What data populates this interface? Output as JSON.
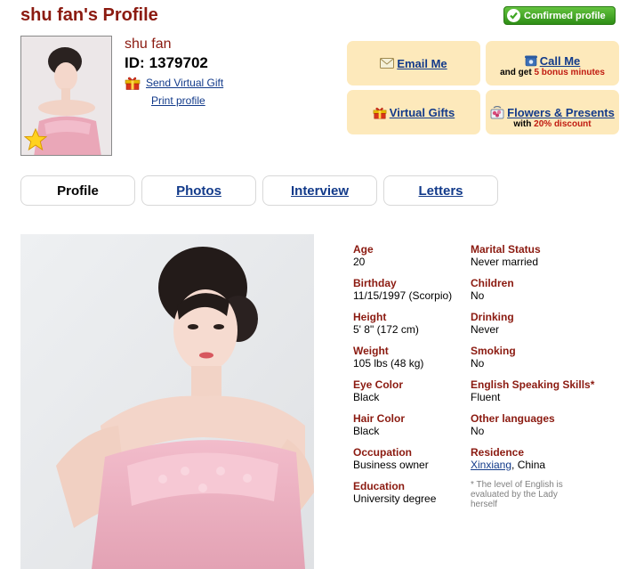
{
  "header": {
    "title": "shu fan's Profile",
    "confirmed_badge": "Confirmed profile"
  },
  "profile": {
    "name": "shu fan",
    "id_label": "ID:",
    "id_value": "1379702",
    "send_gift": "Send Virtual Gift",
    "print_profile": "Print profile"
  },
  "actions": {
    "email": "Email Me",
    "call": "Call Me",
    "call_sub_prefix": "and get",
    "call_sub_highlight": "5 bonus minutes",
    "virtual_gifts": "Virtual Gifts",
    "flowers": "Flowers & Presents",
    "flowers_sub_prefix": "with",
    "flowers_sub_highlight": "20% discount"
  },
  "tabs": [
    {
      "label": "Profile",
      "active": true
    },
    {
      "label": "Photos",
      "active": false
    },
    {
      "label": "Interview",
      "active": false
    },
    {
      "label": "Letters",
      "active": false
    }
  ],
  "details_left": [
    {
      "label": "Age",
      "value": "20"
    },
    {
      "label": "Birthday",
      "value": "11/15/1997 (Scorpio)"
    },
    {
      "label": "Height",
      "value": "5' 8\" (172 cm)"
    },
    {
      "label": "Weight",
      "value": "105 lbs (48 kg)"
    },
    {
      "label": "Eye Color",
      "value": "Black"
    },
    {
      "label": "Hair Color",
      "value": "Black"
    },
    {
      "label": "Occupation",
      "value": "Business owner"
    },
    {
      "label": "Education",
      "value": "University degree"
    }
  ],
  "details_right": [
    {
      "label": "Marital Status",
      "value": "Never married"
    },
    {
      "label": "Children",
      "value": "No"
    },
    {
      "label": "Drinking",
      "value": "Never"
    },
    {
      "label": "Smoking",
      "value": "No"
    },
    {
      "label": "English Speaking Skills*",
      "value": "Fluent"
    },
    {
      "label": "Other languages",
      "value": "No"
    },
    {
      "label": "Residence",
      "value_link": "Xinxiang",
      "value_rest": ", China"
    }
  ],
  "footnote": "* The level of English is evaluated by the Lady herself",
  "icons": {
    "badge": "checkmark-icon",
    "gift": "gift-icon",
    "email": "envelope-icon",
    "call": "phone-icon",
    "flowers": "flowers-icon",
    "star": "star-icon"
  },
  "colors": {
    "title": "#8b1a10",
    "link": "#123a8a",
    "action_bg": "#fde9bb",
    "badge_green": "#3fa623"
  }
}
